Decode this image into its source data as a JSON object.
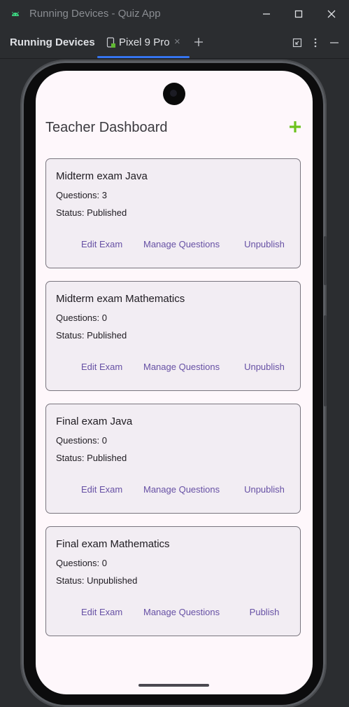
{
  "window": {
    "title": "Running Devices - Quiz App"
  },
  "toolwindow": {
    "title": "Running Devices",
    "tab_label": "Pixel 9 Pro"
  },
  "app": {
    "screen_title": "Teacher Dashboard",
    "accent": "#6650a4",
    "add_color": "#6cc21d",
    "exams": [
      {
        "title": "Midterm exam Java",
        "questions": "Questions: 3",
        "status": "Status: Published",
        "edit": "Edit Exam",
        "manage": "Manage Questions",
        "toggle": "Unpublish"
      },
      {
        "title": "Midterm exam Mathematics",
        "questions": "Questions: 0",
        "status": "Status: Published",
        "edit": "Edit Exam",
        "manage": "Manage Questions",
        "toggle": "Unpublish"
      },
      {
        "title": "Final exam Java",
        "questions": "Questions: 0",
        "status": "Status: Published",
        "edit": "Edit Exam",
        "manage": "Manage Questions",
        "toggle": "Unpublish"
      },
      {
        "title": "Final exam Mathematics",
        "questions": "Questions: 0",
        "status": "Status: Unpublished",
        "edit": "Edit Exam",
        "manage": "Manage Questions",
        "toggle": "Publish"
      }
    ]
  }
}
